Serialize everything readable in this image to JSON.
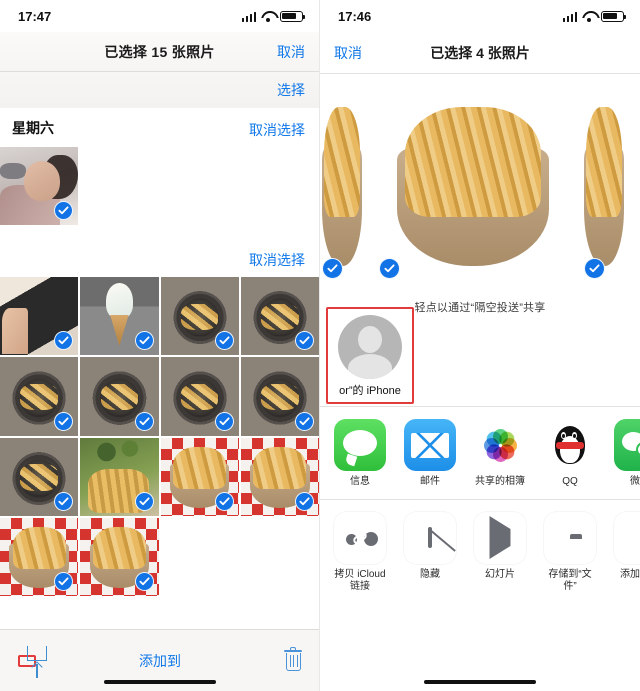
{
  "left": {
    "status": {
      "time": "17:47",
      "signal_icon": "signal-bars-icon",
      "wifi_icon": "wifi-icon",
      "battery_icon": "battery-icon"
    },
    "navbar": {
      "title": "已选择 15 张照片",
      "cancel_label": "取消"
    },
    "subbar": {
      "select_label": "选择"
    },
    "section": {
      "day_label": "星期六",
      "deselect_top_label": "取消选择",
      "deselect_bottom_label": "取消选择"
    },
    "grid": {
      "rows": [
        [
          {
            "art": "phone",
            "selected": true
          },
          {
            "art": "icecream",
            "selected": true
          },
          {
            "art": "pan",
            "selected": true
          },
          {
            "art": "pan",
            "selected": true
          }
        ],
        [
          {
            "art": "pan",
            "selected": true
          },
          {
            "art": "pan",
            "selected": true
          },
          {
            "art": "pan",
            "selected": true
          },
          {
            "art": "pan",
            "selected": true
          }
        ],
        [
          {
            "art": "pan",
            "selected": true
          },
          {
            "art": "greens",
            "selected": true
          },
          {
            "art": "bowl",
            "selected": true
          },
          {
            "art": "bowl",
            "selected": true
          }
        ],
        [
          {
            "art": "bowl",
            "selected": true
          },
          {
            "art": "bowl",
            "selected": true
          }
        ]
      ]
    },
    "toolbar": {
      "share_icon": "share-icon",
      "addto_label": "添加到",
      "trash_icon": "trash-icon"
    }
  },
  "right": {
    "status": {
      "time": "17:46",
      "signal_icon": "signal-bars-icon",
      "wifi_icon": "wifi-icon",
      "battery_icon": "battery-icon"
    },
    "navbar": {
      "cancel_label": "取消",
      "title": "已选择 4 张照片"
    },
    "previews": [
      {
        "selected": true
      },
      {
        "selected": true
      },
      {
        "selected": true
      }
    ],
    "airdrop": {
      "hint": "轻点以通过“隔空投送”共享",
      "contact_name": "or”的 iPhone",
      "avatar_icon": "person-avatar-icon"
    },
    "apps": [
      {
        "label": "信息",
        "icon": "messages-icon"
      },
      {
        "label": "邮件",
        "icon": "mail-icon"
      },
      {
        "label": "共享的相簿",
        "icon": "photos-icon"
      },
      {
        "label": "QQ",
        "icon": "qq-icon"
      },
      {
        "label": "微信",
        "icon": "wechat-icon"
      }
    ],
    "actions": [
      {
        "label": "拷贝 iCloud 链接",
        "icon": "copy-icloud-link-icon"
      },
      {
        "label": "隐藏",
        "icon": "hide-icon"
      },
      {
        "label": "幻灯片",
        "icon": "slideshow-icon"
      },
      {
        "label": "存储到“文件”",
        "icon": "save-to-files-icon"
      },
      {
        "label": "添加到相",
        "icon": "add-to-album-icon"
      }
    ]
  },
  "colors": {
    "accent_blue": "#1178e8",
    "badge_blue": "#1273e6",
    "highlight_red": "#e23b3b"
  }
}
